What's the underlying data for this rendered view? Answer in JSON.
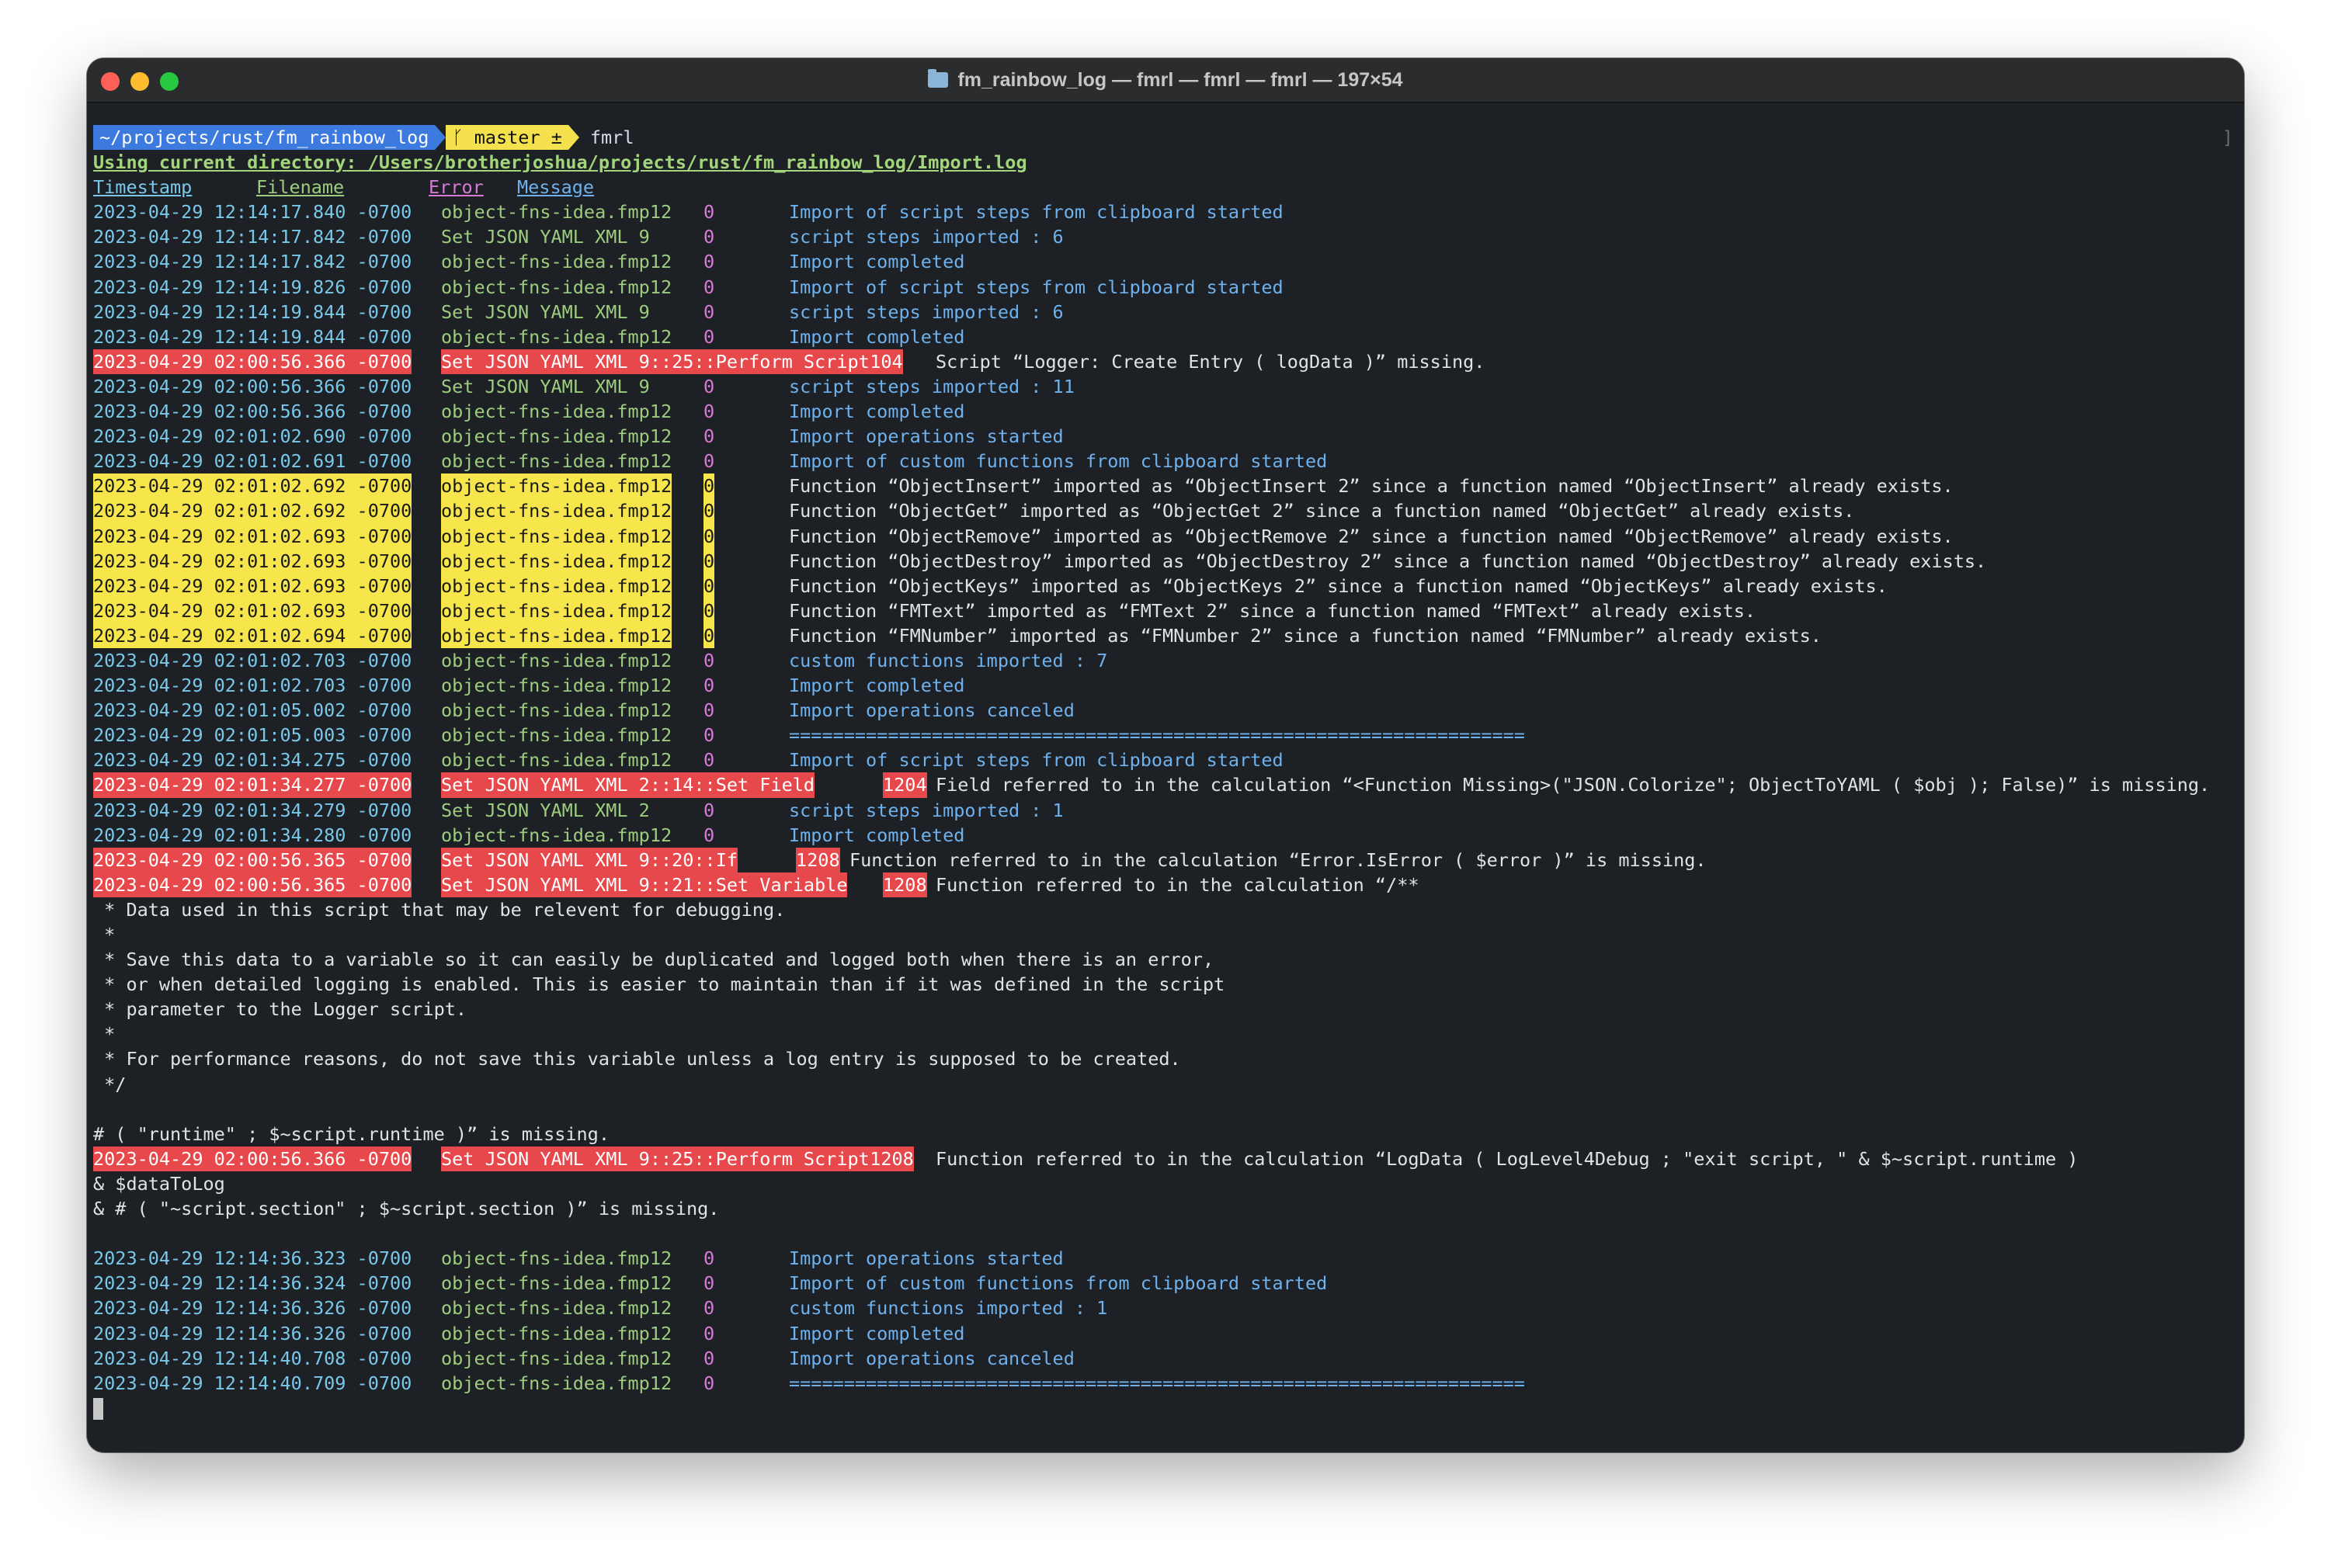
{
  "window": {
    "title": "fm_rainbow_log — fmrl — fmrl — fmrl — 197×54",
    "icon": "folder-icon"
  },
  "prompt": {
    "path": "~/projects/rust/fm_rainbow_log",
    "git": "ᚴ master ±",
    "command": "fmrl",
    "colors": {
      "path_bg": "#3d7ae0",
      "git_bg": "#f4e14d"
    }
  },
  "info_line": "Using current directory: /Users/brotherjoshua/projects/rust/fm_rainbow_log/Import.log",
  "headers": {
    "timestamp": "Timestamp",
    "filename": "Filename",
    "error": "Error",
    "message": "Message"
  },
  "colors": {
    "timestamp": "#79c8ea",
    "filename": "#9dcc7e",
    "error": "#d87ad6",
    "message": "#6eb1ec",
    "error_bg": "#e7484b",
    "warn_bg": "#f6e64b"
  },
  "entries": [
    {
      "ts": "2023-04-29 12:14:17.840 -0700",
      "file": "object-fns-idea.fmp12",
      "err": "0",
      "msg": "Import of script steps from clipboard started"
    },
    {
      "ts": "2023-04-29 12:14:17.842 -0700",
      "file": "Set JSON YAML XML 9",
      "err": "0",
      "msg": "script steps imported : 6"
    },
    {
      "ts": "2023-04-29 12:14:17.842 -0700",
      "file": "object-fns-idea.fmp12",
      "err": "0",
      "msg": "Import completed"
    },
    {
      "ts": "2023-04-29 12:14:19.826 -0700",
      "file": "object-fns-idea.fmp12",
      "err": "0",
      "msg": "Import of script steps from clipboard started"
    },
    {
      "ts": "2023-04-29 12:14:19.844 -0700",
      "file": "Set JSON YAML XML 9",
      "err": "0",
      "msg": "script steps imported : 6"
    },
    {
      "ts": "2023-04-29 12:14:19.844 -0700",
      "file": "object-fns-idea.fmp12",
      "err": "0",
      "msg": "Import completed"
    },
    {
      "level": "error",
      "ts": "2023-04-29 02:00:56.366 -0700",
      "file": "Set JSON YAML XML 9::25::Perform Script",
      "err": "104",
      "msg": "Script “Logger: Create Entry ( logData )” missing.",
      "msg_col": 1085
    },
    {
      "ts": "2023-04-29 02:00:56.366 -0700",
      "file": "Set JSON YAML XML 9",
      "err": "0",
      "msg": "script steps imported : 11"
    },
    {
      "ts": "2023-04-29 02:00:56.366 -0700",
      "file": "object-fns-idea.fmp12",
      "err": "0",
      "msg": "Import completed"
    },
    {
      "ts": "2023-04-29 02:01:02.690 -0700",
      "file": "object-fns-idea.fmp12",
      "err": "0",
      "msg": "Import operations started"
    },
    {
      "ts": "2023-04-29 02:01:02.691 -0700",
      "file": "object-fns-idea.fmp12",
      "err": "0",
      "msg": "Import of custom functions from clipboard started"
    },
    {
      "level": "warn",
      "ts": "2023-04-29 02:01:02.692 -0700",
      "file": "object-fns-idea.fmp12",
      "err": "0",
      "msg": "Function “ObjectInsert” imported as “ObjectInsert 2” since a function named “ObjectInsert” already exists."
    },
    {
      "level": "warn",
      "ts": "2023-04-29 02:01:02.692 -0700",
      "file": "object-fns-idea.fmp12",
      "err": "0",
      "msg": "Function “ObjectGet” imported as “ObjectGet 2” since a function named “ObjectGet” already exists."
    },
    {
      "level": "warn",
      "ts": "2023-04-29 02:01:02.693 -0700",
      "file": "object-fns-idea.fmp12",
      "err": "0",
      "msg": "Function “ObjectRemove” imported as “ObjectRemove 2” since a function named “ObjectRemove” already exists."
    },
    {
      "level": "warn",
      "ts": "2023-04-29 02:01:02.693 -0700",
      "file": "object-fns-idea.fmp12",
      "err": "0",
      "msg": "Function “ObjectDestroy” imported as “ObjectDestroy 2” since a function named “ObjectDestroy” already exists."
    },
    {
      "level": "warn",
      "ts": "2023-04-29 02:01:02.693 -0700",
      "file": "object-fns-idea.fmp12",
      "err": "0",
      "msg": "Function “ObjectKeys” imported as “ObjectKeys 2” since a function named “ObjectKeys” already exists."
    },
    {
      "level": "warn",
      "ts": "2023-04-29 02:01:02.693 -0700",
      "file": "object-fns-idea.fmp12",
      "err": "0",
      "msg": "Function “FMText” imported as “FMText 2” since a function named “FMText” already exists."
    },
    {
      "level": "warn",
      "ts": "2023-04-29 02:01:02.694 -0700",
      "file": "object-fns-idea.fmp12",
      "err": "0",
      "msg": "Function “FMNumber” imported as “FMNumber 2” since a function named “FMNumber” already exists."
    },
    {
      "ts": "2023-04-29 02:01:02.703 -0700",
      "file": "object-fns-idea.fmp12",
      "err": "0",
      "msg": "custom functions imported : 7"
    },
    {
      "ts": "2023-04-29 02:01:02.703 -0700",
      "file": "object-fns-idea.fmp12",
      "err": "0",
      "msg": "Import completed"
    },
    {
      "ts": "2023-04-29 02:01:05.002 -0700",
      "file": "object-fns-idea.fmp12",
      "err": "0",
      "msg": "Import operations canceled"
    },
    {
      "ts": "2023-04-29 02:01:05.003 -0700",
      "file": "object-fns-idea.fmp12",
      "err": "0",
      "msg": "==================================================================="
    },
    {
      "ts": "2023-04-29 02:01:34.275 -0700",
      "file": "object-fns-idea.fmp12",
      "err": "0",
      "msg": "Import of script steps from clipboard started"
    },
    {
      "level": "error",
      "ts": "2023-04-29 02:01:34.277 -0700",
      "file": "Set JSON YAML XML 2::14::Set Field",
      "err": "1204",
      "err_col": 1017,
      "msg": "Field referred to in the calculation “<Function Missing>(\"JSON.Colorize\"; ObjectToYAML ( $obj ); False)” is missing.",
      "msg_col": 1085
    },
    {
      "ts": "2023-04-29 02:01:34.279 -0700",
      "file": "Set JSON YAML XML 2",
      "err": "0",
      "msg": "script steps imported : 1"
    },
    {
      "ts": "2023-04-29 02:01:34.280 -0700",
      "file": "object-fns-idea.fmp12",
      "err": "0",
      "msg": "Import completed"
    },
    {
      "level": "error",
      "ts": "2023-04-29 02:00:56.365 -0700",
      "file": "Set JSON YAML XML 9::20::If",
      "err": "1208",
      "err_col": 905,
      "msg": "Function referred to in the calculation “Error.IsError ( $error )” is missing.",
      "msg_col": 974
    },
    {
      "level": "error",
      "ts": "2023-04-29 02:00:56.365 -0700",
      "file": "Set JSON YAML XML 9::21::Set Variable",
      "err": "1208",
      "err_col": 1017,
      "msg": "Function referred to in the calculation “/**",
      "msg_col": 1085
    }
  ],
  "continuation_1": [
    " * Data used in this script that may be relevent for debugging.",
    " *",
    " * Save this data to a variable so it can easily be duplicated and logged both when there is an error,",
    " * or when detailed logging is enabled. This is easier to maintain than if it was defined in the script",
    " * parameter to the Logger script.",
    " *",
    " * For performance reasons, do not save this variable unless a log entry is supposed to be created.",
    " */",
    "",
    "# ( \"runtime\" ; $~script.runtime )” is missing."
  ],
  "entries_2": [
    {
      "level": "error",
      "ts": "2023-04-29 02:00:56.366 -0700",
      "file": "Set JSON YAML XML 9::25::Perform Script",
      "err": "1208",
      "msg": "Function referred to in the calculation “LogData ( LogLevel4Debug ; \"exit script, \" & $~script.runtime )",
      "msg_col": 1085
    }
  ],
  "continuation_2": [
    "& $dataToLog",
    "& # ( \"~script.section\" ; $~script.section )” is missing.",
    ""
  ],
  "entries_3": [
    {
      "ts": "2023-04-29 12:14:36.323 -0700",
      "file": "object-fns-idea.fmp12",
      "err": "0",
      "msg": "Import operations started"
    },
    {
      "ts": "2023-04-29 12:14:36.324 -0700",
      "file": "object-fns-idea.fmp12",
      "err": "0",
      "msg": "Import of custom functions from clipboard started"
    },
    {
      "ts": "2023-04-29 12:14:36.326 -0700",
      "file": "object-fns-idea.fmp12",
      "err": "0",
      "msg": "custom functions imported : 1"
    },
    {
      "ts": "2023-04-29 12:14:36.326 -0700",
      "file": "object-fns-idea.fmp12",
      "err": "0",
      "msg": "Import completed"
    },
    {
      "ts": "2023-04-29 12:14:40.708 -0700",
      "file": "object-fns-idea.fmp12",
      "err": "0",
      "msg": "Import operations canceled"
    },
    {
      "ts": "2023-04-29 12:14:40.709 -0700",
      "file": "object-fns-idea.fmp12",
      "err": "0",
      "msg": "==================================================================="
    }
  ]
}
